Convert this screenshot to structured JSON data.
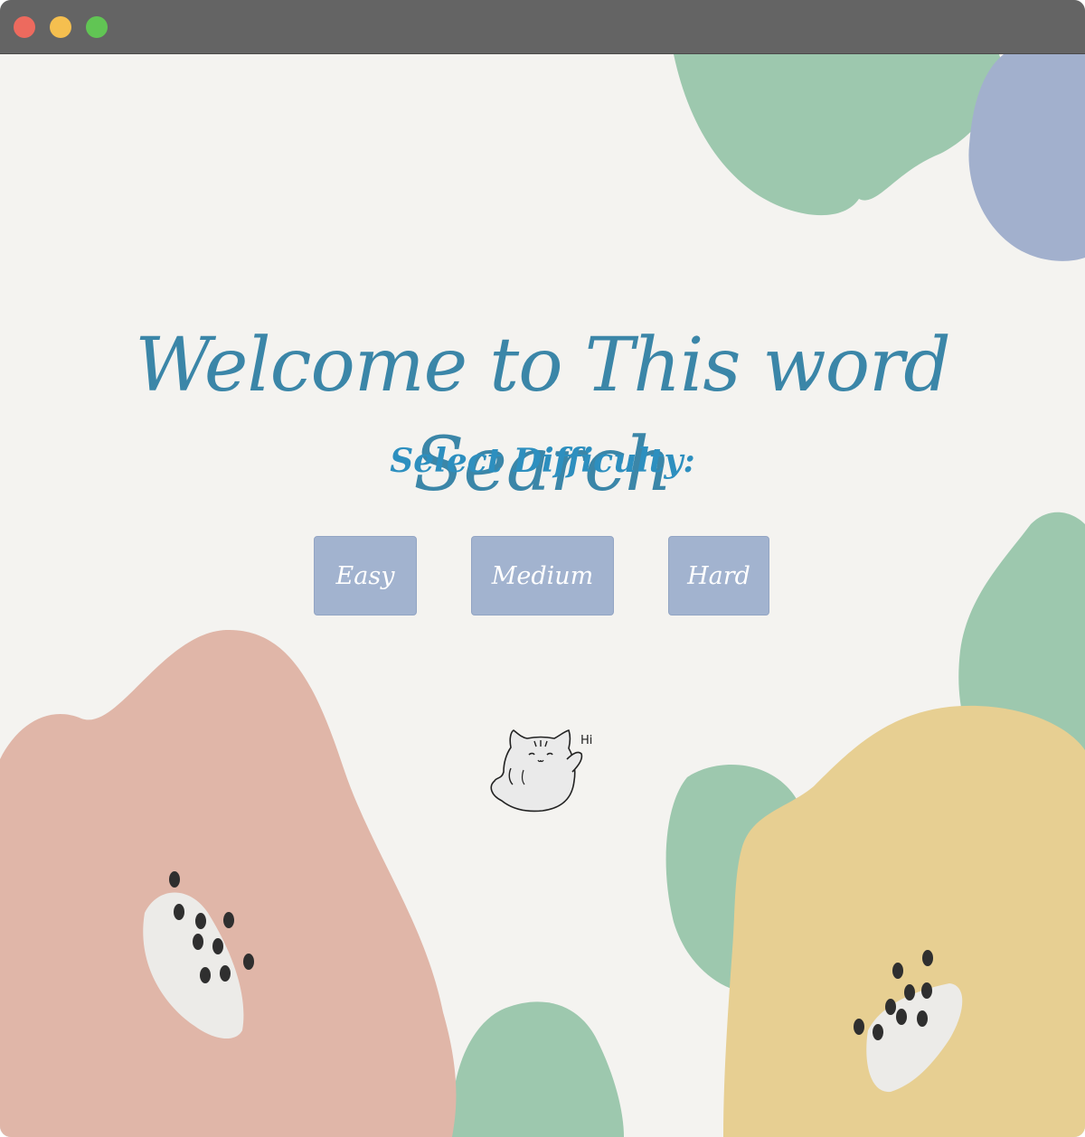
{
  "window": {
    "controls": [
      "close",
      "minimize",
      "maximize"
    ]
  },
  "page": {
    "title": "Welcome to This word Search",
    "subtitle": "Select Difficulty:",
    "mascot_greeting": "Hi"
  },
  "difficulty": {
    "easy_label": "Easy",
    "medium_label": "Medium",
    "hard_label": "Hard"
  },
  "colors": {
    "title": "#3b86a8",
    "subtitle": "#2d8fbf",
    "button_bg": "#a2b3cf",
    "button_text": "#ffffff",
    "background": "#f4f3f0",
    "blob_green": "#9dc8ae",
    "blob_blue": "#a2b0cd",
    "blob_pink": "#e0b6a8",
    "blob_yellow": "#e7cf92",
    "titlebar": "#646464"
  },
  "icons": {
    "close": "close-icon",
    "minimize": "minimize-icon",
    "maximize": "maximize-icon",
    "mascot": "cat-icon"
  }
}
